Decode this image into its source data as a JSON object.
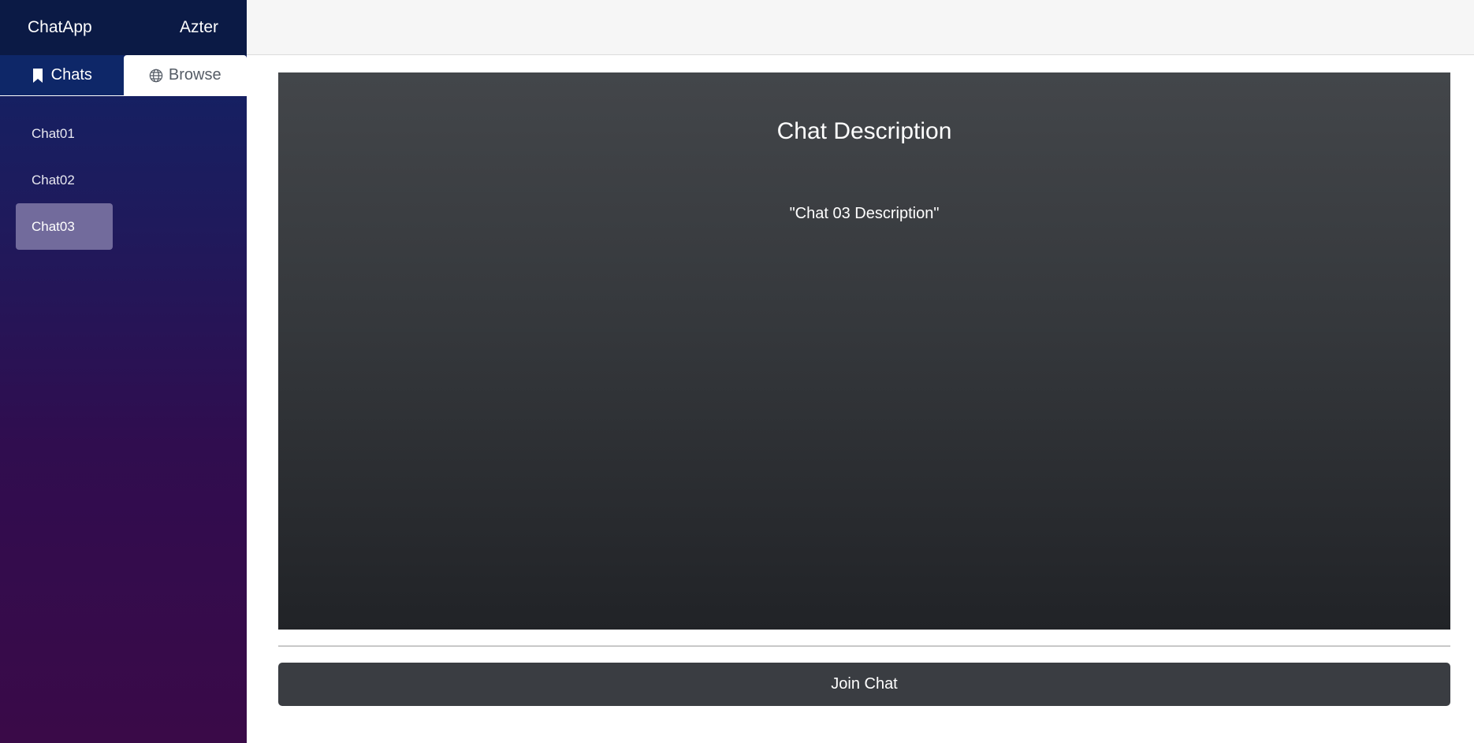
{
  "sidebar": {
    "app_name": "ChatApp",
    "username": "Azter",
    "tabs": [
      {
        "label": "Chats",
        "icon": "bookmark-icon",
        "active": true
      },
      {
        "label": "Browse",
        "icon": "globe-icon",
        "active": false
      }
    ],
    "chats": [
      {
        "label": "Chat01",
        "selected": false
      },
      {
        "label": "Chat02",
        "selected": false
      },
      {
        "label": "Chat03",
        "selected": true
      }
    ]
  },
  "main": {
    "description_title": "Chat Description",
    "description_text": "\"Chat 03 Description\"",
    "join_label": "Join Chat"
  },
  "colors": {
    "sidebar_top": "#0f2466",
    "sidebar_bottom": "#3a0a48",
    "selected_item": "#726b9c",
    "card": "#35383c",
    "button": "#3a3d42"
  }
}
